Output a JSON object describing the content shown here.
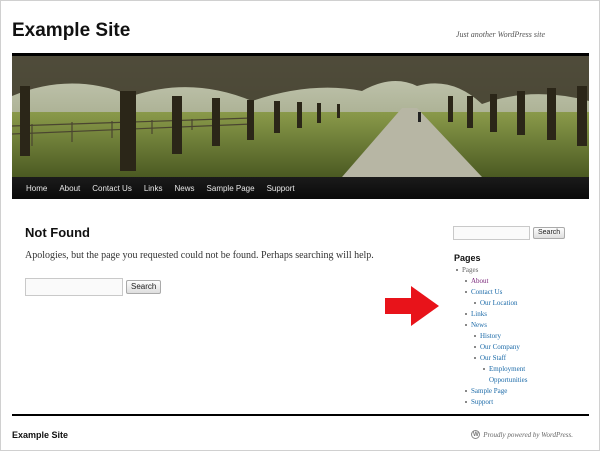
{
  "site": {
    "title": "Example Site",
    "description": "Just another WordPress site"
  },
  "nav": {
    "items": [
      "Home",
      "About",
      "Contact Us",
      "Links",
      "News",
      "Sample Page",
      "Support"
    ]
  },
  "content": {
    "heading": "Not Found",
    "message": "Apologies, but the page you requested could not be found. Perhaps searching will help.",
    "search_button": "Search",
    "search_value": ""
  },
  "sidebar": {
    "search_button": "Search",
    "search_value": "",
    "widget_title": "Pages",
    "pages": {
      "root": "Pages",
      "about": "About",
      "contact": "Contact Us",
      "our_location": "Our Location",
      "links": "Links",
      "news": "News",
      "history": "History",
      "our_company": "Our Company",
      "our_staff": "Our Staff",
      "employment_1": "Employment",
      "employment_2": "Opportunities",
      "sample_page": "Sample Page",
      "support": "Support"
    }
  },
  "footer": {
    "site_title": "Example Site",
    "credit": "Proudly powered by WordPress."
  },
  "colors": {
    "link": "#1b6aa8",
    "visited_link": "#7a267a",
    "nav_bg": "#111111",
    "arrow": "#e8131a"
  },
  "icons": {
    "arrow": "red-right-arrow",
    "footer": "wordpress-logo"
  }
}
